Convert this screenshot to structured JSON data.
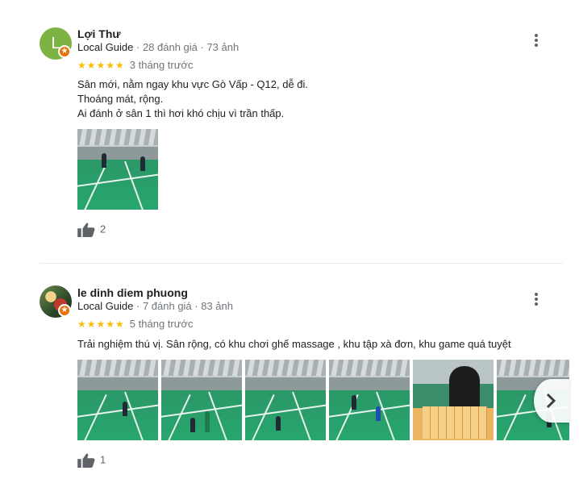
{
  "reviews": [
    {
      "avatar_letter": "L",
      "badge": "★",
      "name": "Lợi Thư",
      "guide": "Local Guide",
      "stats": " · 28 đánh giá · 73 ảnh",
      "rating": "★★★★★",
      "time": "3 tháng trước",
      "lines": [
        "Sân mới, nằm ngay khu vực Gò Vấp - Q12, dễ đi.",
        "Thoáng mát, rộng.",
        "Ai đánh ở sân 1 thì hơi khó chịu vì trần thấp."
      ],
      "likes": "2"
    },
    {
      "badge": "★",
      "name": "le dinh diem phuong",
      "guide": "Local Guide",
      "stats": " · 7 đánh giá · 83 ảnh",
      "rating": "★★★★★",
      "time": "5 tháng trước",
      "lines": [
        "Trải nghiệm thú vị. Sân rộng, có khu chơi ghế massage , khu tập xà đơn, khu game quá tuyệt"
      ],
      "likes": "1"
    }
  ],
  "icons": {
    "menu": "more-vert-icon",
    "like": "thumb-up-icon",
    "next": "chevron-right-icon",
    "badge": "local-guide-star-icon"
  },
  "colors": {
    "star": "#fbbc04",
    "avatar_green": "#7cb342",
    "badge_orange": "#e8710a",
    "meta_gray": "#70757a"
  }
}
